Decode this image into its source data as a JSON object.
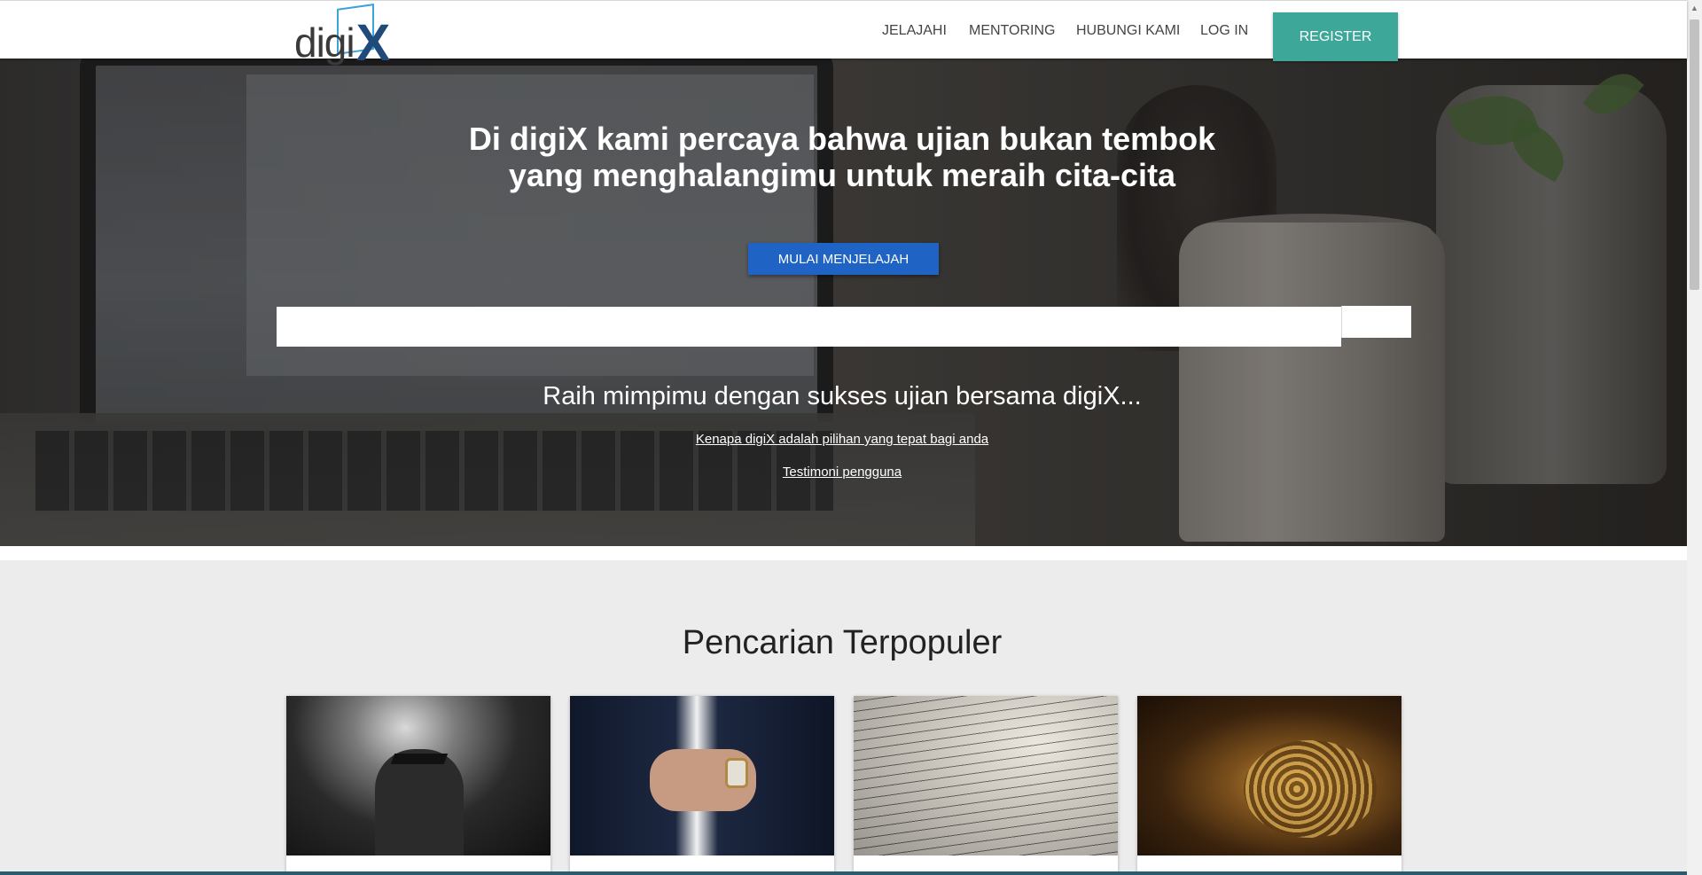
{
  "navbar": {
    "logo": {
      "text_main": "digi",
      "text_accent": "X"
    },
    "links": [
      {
        "label": "JELAJAHI"
      },
      {
        "label": "MENTORING"
      },
      {
        "label": "HUBUNGI KAMI"
      },
      {
        "label": "LOG IN"
      }
    ],
    "register_label": "REGISTER",
    "register_color": "#3da79a"
  },
  "hero": {
    "title_line1": "Di digiX kami percaya bahwa ujian bukan tembok",
    "title_line2": "yang menghalangimu untuk meraih cita-cita",
    "cta_label": "MULAI MENJELAJAH",
    "cta_color": "#1f64c4",
    "search_placeholder": "",
    "subtitle": "Raih mimpimu dengan sukses ujian bersama digiX...",
    "link_why": "Kenapa digiX adalah pilihan yang tepat bagi anda",
    "link_testimonials": "Testimoni pengguna"
  },
  "popular": {
    "title": "Pencarian Terpopuler",
    "cards": [
      {
        "image": "graduate-photo"
      },
      {
        "image": "suit-watch-photo"
      },
      {
        "image": "dictionary-photo"
      },
      {
        "image": "typewriter-photo"
      }
    ]
  }
}
